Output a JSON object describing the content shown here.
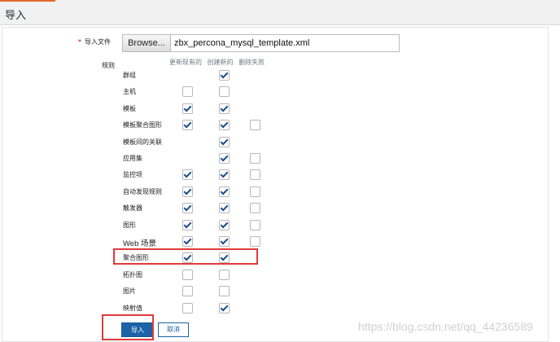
{
  "page": {
    "title": "导入"
  },
  "colors": {
    "accent": "#e26a2c",
    "primary": "#1d63a8",
    "highlight": "#e03a3a"
  },
  "form": {
    "file_label": "导入文件",
    "required_mark": "*",
    "browse_label": "Browse...",
    "file_name": "zbx_percona_mysql_template.xml",
    "rules_label": "规则",
    "columns": [
      "更新现有的",
      "创建新的",
      "删除失败"
    ],
    "rules": [
      {
        "label": "群组",
        "update": null,
        "create": true,
        "delete": null
      },
      {
        "label": "主机",
        "update": false,
        "create": false,
        "delete": null
      },
      {
        "label": "模板",
        "update": true,
        "create": true,
        "delete": null
      },
      {
        "label": "模板聚合图形",
        "update": true,
        "create": true,
        "delete": false
      },
      {
        "label": "模板间的关联",
        "update": null,
        "create": true,
        "delete": null
      },
      {
        "label": "应用集",
        "update": null,
        "create": true,
        "delete": false
      },
      {
        "label": "监控项",
        "update": true,
        "create": true,
        "delete": false
      },
      {
        "label": "自动发现规则",
        "update": true,
        "create": true,
        "delete": false
      },
      {
        "label": "触发器",
        "update": true,
        "create": true,
        "delete": false
      },
      {
        "label": "图形",
        "update": true,
        "create": true,
        "delete": false
      },
      {
        "label": "Web 场景",
        "update": true,
        "create": true,
        "delete": false
      },
      {
        "label": "聚合图形",
        "update": true,
        "create": true,
        "delete": null
      },
      {
        "label": "拓扑图",
        "update": false,
        "create": false,
        "delete": null
      },
      {
        "label": "图片",
        "update": false,
        "create": false,
        "delete": null
      },
      {
        "label": "映射值",
        "update": false,
        "create": true,
        "delete": null
      }
    ],
    "import_button": "导入",
    "cancel_button": "取消"
  },
  "watermark": "https://blog.csdn.net/qq_44236589"
}
